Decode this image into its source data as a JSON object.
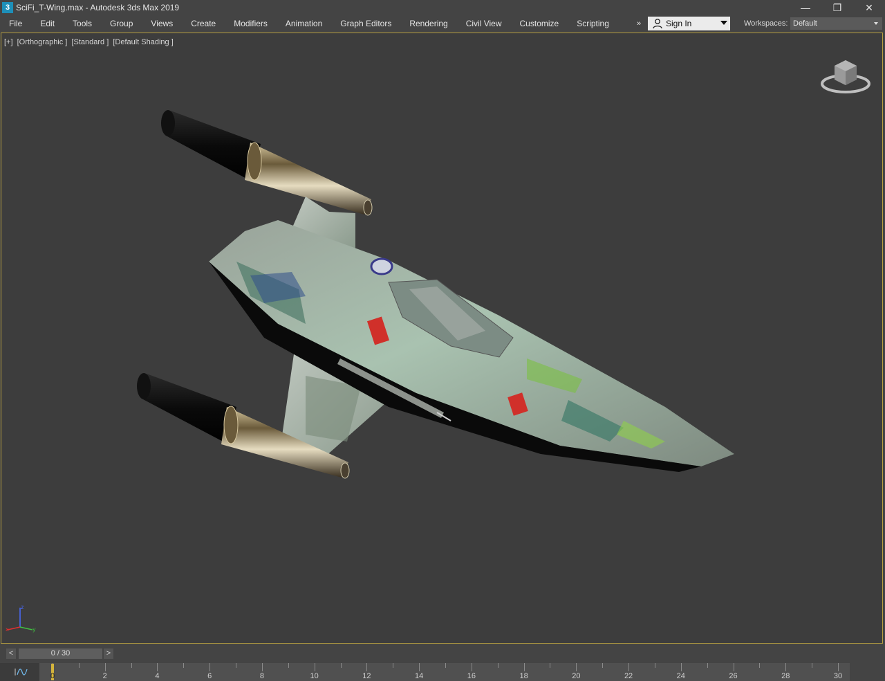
{
  "window": {
    "app_icon": "3",
    "title": "SciFi_T-Wing.max - Autodesk 3ds Max 2019",
    "controls": {
      "minimize": "—",
      "restore": "❐",
      "close": "✕"
    }
  },
  "menu": {
    "items": [
      {
        "label": "File"
      },
      {
        "label": "Edit"
      },
      {
        "label": "Tools"
      },
      {
        "label": "Group"
      },
      {
        "label": "Views"
      },
      {
        "label": "Create"
      },
      {
        "label": "Modifiers"
      },
      {
        "label": "Animation"
      },
      {
        "label": "Graph Editors"
      },
      {
        "label": "Rendering"
      },
      {
        "label": "Civil View"
      },
      {
        "label": "Customize"
      },
      {
        "label": "Scripting"
      }
    ],
    "overflow": "»",
    "sign_in": "Sign In",
    "workspaces_label": "Workspaces:",
    "workspace_value": "Default"
  },
  "viewport": {
    "labels": [
      "[+]",
      "[Orthographic ]",
      "[Standard ]",
      "[Default Shading ]"
    ],
    "axis": {
      "x": "x",
      "y": "y",
      "z": "z"
    },
    "colors": {
      "border": "#b8a040",
      "background": "#3d3d3d"
    }
  },
  "timeline": {
    "prev": "<",
    "next": ">",
    "frame_display": "0 / 30",
    "current_frame": 0,
    "ticks": [
      "0",
      "2",
      "4",
      "6",
      "8",
      "10",
      "12",
      "14",
      "16",
      "18",
      "20",
      "22",
      "24",
      "26",
      "28",
      "30"
    ]
  }
}
